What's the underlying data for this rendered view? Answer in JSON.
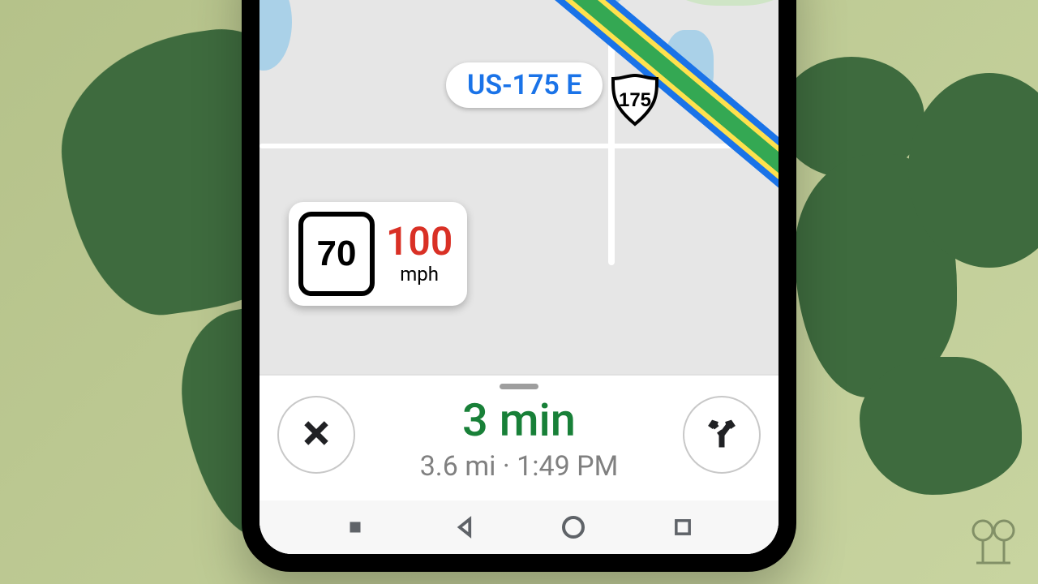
{
  "route": {
    "label": "US-175 E",
    "shield_number": "175"
  },
  "speed": {
    "limit": "70",
    "current": "100",
    "unit": "mph"
  },
  "eta": {
    "time_value": "3",
    "time_unit": "min",
    "distance": "3.6 mi",
    "arrival": "1:49 PM",
    "separator": "  ·  "
  },
  "colors": {
    "highway_blue": "#1a73e8",
    "eta_green": "#188038",
    "speed_red": "#d93025"
  }
}
